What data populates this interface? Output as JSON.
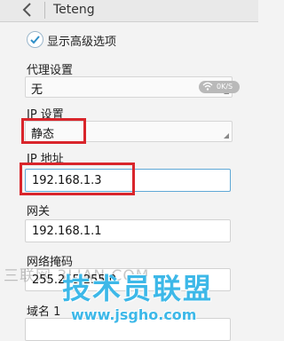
{
  "header": {
    "title": "Teteng",
    "back_icon": "chevron-left-icon"
  },
  "advanced": {
    "label": "显示高级选项",
    "checked": true
  },
  "proxy": {
    "label": "代理设置",
    "value": "无"
  },
  "status": {
    "speed": "0K/S",
    "icon": "wifi-icon"
  },
  "ip_settings": {
    "label": "IP 设置",
    "value": "静态"
  },
  "ip_address": {
    "label": "IP 地址",
    "value": "192.168.1.3"
  },
  "gateway": {
    "label": "网关",
    "value": "192.168.1.1"
  },
  "netmask": {
    "label": "网络掩码",
    "value": "255.255.255.0"
  },
  "dns1": {
    "label": "域名 1"
  },
  "watermark": {
    "line": "三联网 3LIAN.COM",
    "big": "技术员联盟",
    "url": "www.jsgho.com"
  },
  "colors": {
    "highlight": "#d9252b",
    "focus": "#5fa8d6",
    "watermark": "#3db8e8"
  }
}
